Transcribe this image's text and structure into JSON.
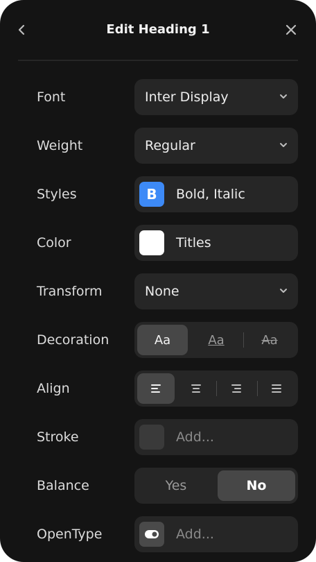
{
  "header": {
    "title": "Edit Heading 1",
    "back_icon": "chevron-left-icon",
    "close_icon": "close-icon"
  },
  "rows": {
    "font": {
      "label": "Font",
      "value": "Inter Display"
    },
    "weight": {
      "label": "Weight",
      "value": "Regular"
    },
    "styles": {
      "label": "Styles",
      "value": "Bold, Italic",
      "icon_letter": "B",
      "icon_color": "#3d8af7"
    },
    "color": {
      "label": "Color",
      "value": "Titles",
      "swatch": "#ffffff"
    },
    "transform": {
      "label": "Transform",
      "value": "None"
    },
    "decoration": {
      "label": "Decoration",
      "options": [
        "Aa",
        "Aa",
        "Aa"
      ],
      "selected": 0
    },
    "align": {
      "label": "Align",
      "options": [
        "align-left-icon",
        "align-center-icon",
        "align-right-icon",
        "align-justify-icon"
      ],
      "selected": 0
    },
    "stroke": {
      "label": "Stroke",
      "placeholder": "Add..."
    },
    "balance": {
      "label": "Balance",
      "options": [
        "Yes",
        "No"
      ],
      "selected": 1
    },
    "opentype": {
      "label": "OpenType",
      "placeholder": "Add..."
    }
  }
}
